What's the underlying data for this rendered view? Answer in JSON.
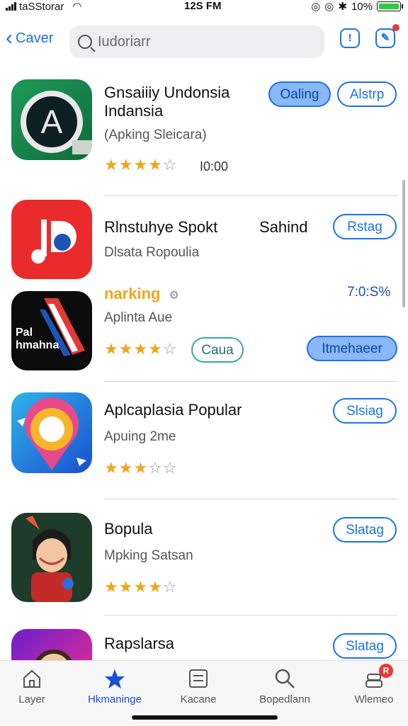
{
  "status": {
    "carrier": "taSStorar",
    "time": "12S FM",
    "battery": "10%"
  },
  "nav": {
    "back_label": "Caver",
    "search_placeholder": "Iudoriarr"
  },
  "apps": [
    {
      "title": "Gnsaiiiy Undonsia Indansia",
      "subtitle": "(Apking Sleicara)",
      "stars": 4,
      "meta": "I0:00",
      "buttons": [
        "Oaling",
        "Alstrp"
      ]
    },
    {
      "title": "Rlnstuhye Spokt",
      "title_right": "Sahind",
      "subtitle": "Dlsata Ropoulia",
      "buttons": [
        "Rstag"
      ]
    },
    {
      "highlight": "narking",
      "meta": "7:0:S%",
      "icon_text": "Pal hmahna",
      "subtitle": "Aplinta Aue",
      "stars": 4,
      "buttons": [
        "Caua",
        "Itmehaeer"
      ]
    },
    {
      "title": "Aplcaplasia Popular",
      "subtitle": "Apuing 2me",
      "stars": 3,
      "buttons": [
        "Slsiag"
      ]
    },
    {
      "title": "Bopula",
      "subtitle": "Mpking Satsan",
      "stars": 4,
      "buttons": [
        "Slatag"
      ]
    },
    {
      "title": "Rapslarsa",
      "buttons": [
        "Slatag"
      ]
    }
  ],
  "tabs": [
    {
      "label": "Layer",
      "icon": "home-icon"
    },
    {
      "label": "Hkmaninge",
      "icon": "star-icon"
    },
    {
      "label": "Kacane",
      "icon": "document-icon"
    },
    {
      "label": "Bopedlann",
      "icon": "search-icon"
    },
    {
      "label": "Wlemeo",
      "icon": "stack-icon"
    }
  ],
  "tab_badge": "R",
  "colors": {
    "accent": "#1a73e8",
    "star": "#f1a51b"
  }
}
